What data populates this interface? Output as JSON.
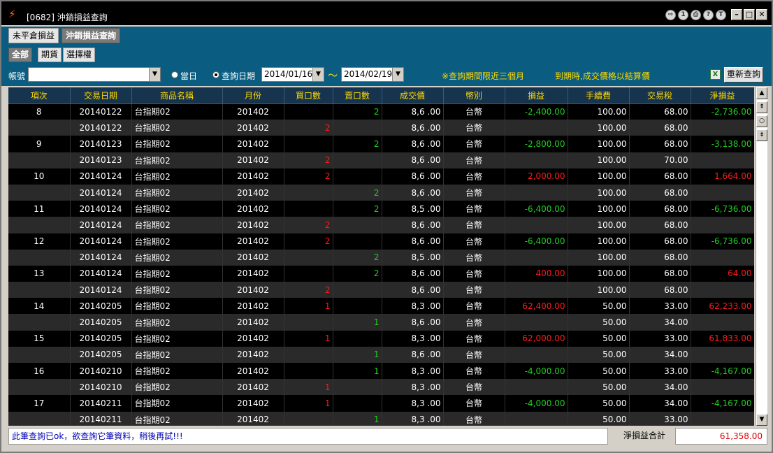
{
  "window": {
    "title": "[0682] 沖銷損益查詢"
  },
  "tabs_top": [
    "未平倉損益",
    "沖銷損益查詢"
  ],
  "tabs_sub": [
    "全部",
    "期貨",
    "選擇權"
  ],
  "filter": {
    "account_label": "帳號",
    "account_value": "",
    "radio_today": "當日",
    "radio_query": "查詢日期",
    "date_from": "2014/01/16",
    "tilde": "～",
    "date_to": "2014/02/19",
    "note1": "※查詢期間限近三個月",
    "note2": "到期時,成交價格以結算價",
    "requery": "重新查詢"
  },
  "columns": [
    "項次",
    "交易日期",
    "商品名稱",
    "月份",
    "買口數",
    "賣口數",
    "成交價",
    "幣別",
    "損益",
    "手續費",
    "交易稅",
    "淨損益"
  ],
  "rows": [
    {
      "no": "8",
      "date": "20140122",
      "name": "台指期02",
      "month": "201402",
      "buy": "",
      "sell": "2",
      "price": "8,6 .00",
      "cur": "台幣",
      "pl": "-2,400.00",
      "fee": "100.00",
      "tax": "68.00",
      "net": "-2,736.00"
    },
    {
      "no": "",
      "date": "20140122",
      "name": "台指期02",
      "month": "201402",
      "buy": "2",
      "sell": "",
      "price": "8,6 .00",
      "cur": "台幣",
      "pl": "",
      "fee": "100.00",
      "tax": "68.00",
      "net": ""
    },
    {
      "no": "9",
      "date": "20140123",
      "name": "台指期02",
      "month": "201402",
      "buy": "",
      "sell": "2",
      "price": "8,6 .00",
      "cur": "台幣",
      "pl": "-2,800.00",
      "fee": "100.00",
      "tax": "68.00",
      "net": "-3,138.00"
    },
    {
      "no": "",
      "date": "20140123",
      "name": "台指期02",
      "month": "201402",
      "buy": "2",
      "sell": "",
      "price": "8,6 .00",
      "cur": "台幣",
      "pl": "",
      "fee": "100.00",
      "tax": "70.00",
      "net": ""
    },
    {
      "no": "10",
      "date": "20140124",
      "name": "台指期02",
      "month": "201402",
      "buy": "2",
      "sell": "",
      "price": "8,6 .00",
      "cur": "台幣",
      "pl": "2,000.00",
      "fee": "100.00",
      "tax": "68.00",
      "net": "1,664.00"
    },
    {
      "no": "",
      "date": "20140124",
      "name": "台指期02",
      "month": "201402",
      "buy": "",
      "sell": "2",
      "price": "8,6 .00",
      "cur": "台幣",
      "pl": "",
      "fee": "100.00",
      "tax": "68.00",
      "net": ""
    },
    {
      "no": "11",
      "date": "20140124",
      "name": "台指期02",
      "month": "201402",
      "buy": "",
      "sell": "2",
      "price": "8,5 .00",
      "cur": "台幣",
      "pl": "-6,400.00",
      "fee": "100.00",
      "tax": "68.00",
      "net": "-6,736.00"
    },
    {
      "no": "",
      "date": "20140124",
      "name": "台指期02",
      "month": "201402",
      "buy": "2",
      "sell": "",
      "price": "8,6 .00",
      "cur": "台幣",
      "pl": "",
      "fee": "100.00",
      "tax": "68.00",
      "net": ""
    },
    {
      "no": "12",
      "date": "20140124",
      "name": "台指期02",
      "month": "201402",
      "buy": "2",
      "sell": "",
      "price": "8,6 .00",
      "cur": "台幣",
      "pl": "-6,400.00",
      "fee": "100.00",
      "tax": "68.00",
      "net": "-6,736.00"
    },
    {
      "no": "",
      "date": "20140124",
      "name": "台指期02",
      "month": "201402",
      "buy": "",
      "sell": "2",
      "price": "8,5 .00",
      "cur": "台幣",
      "pl": "",
      "fee": "100.00",
      "tax": "68.00",
      "net": ""
    },
    {
      "no": "13",
      "date": "20140124",
      "name": "台指期02",
      "month": "201402",
      "buy": "",
      "sell": "2",
      "price": "8,6 .00",
      "cur": "台幣",
      "pl": "400.00",
      "fee": "100.00",
      "tax": "68.00",
      "net": "64.00"
    },
    {
      "no": "",
      "date": "20140124",
      "name": "台指期02",
      "month": "201402",
      "buy": "2",
      "sell": "",
      "price": "8,6 .00",
      "cur": "台幣",
      "pl": "",
      "fee": "100.00",
      "tax": "68.00",
      "net": ""
    },
    {
      "no": "14",
      "date": "20140205",
      "name": "台指期02",
      "month": "201402",
      "buy": "1",
      "sell": "",
      "price": "8,3 .00",
      "cur": "台幣",
      "pl": "62,400.00",
      "fee": "50.00",
      "tax": "33.00",
      "net": "62,233.00"
    },
    {
      "no": "",
      "date": "20140205",
      "name": "台指期02",
      "month": "201402",
      "buy": "",
      "sell": "1",
      "price": "8,6 .00",
      "cur": "台幣",
      "pl": "",
      "fee": "50.00",
      "tax": "34.00",
      "net": ""
    },
    {
      "no": "15",
      "date": "20140205",
      "name": "台指期02",
      "month": "201402",
      "buy": "1",
      "sell": "",
      "price": "8,3 .00",
      "cur": "台幣",
      "pl": "62,000.00",
      "fee": "50.00",
      "tax": "33.00",
      "net": "61,833.00"
    },
    {
      "no": "",
      "date": "20140205",
      "name": "台指期02",
      "month": "201402",
      "buy": "",
      "sell": "1",
      "price": "8,6 .00",
      "cur": "台幣",
      "pl": "",
      "fee": "50.00",
      "tax": "34.00",
      "net": ""
    },
    {
      "no": "16",
      "date": "20140210",
      "name": "台指期02",
      "month": "201402",
      "buy": "",
      "sell": "1",
      "price": "8,3 .00",
      "cur": "台幣",
      "pl": "-4,000.00",
      "fee": "50.00",
      "tax": "33.00",
      "net": "-4,167.00"
    },
    {
      "no": "",
      "date": "20140210",
      "name": "台指期02",
      "month": "201402",
      "buy": "1",
      "sell": "",
      "price": "8,3 .00",
      "cur": "台幣",
      "pl": "",
      "fee": "50.00",
      "tax": "34.00",
      "net": ""
    },
    {
      "no": "17",
      "date": "20140211",
      "name": "台指期02",
      "month": "201402",
      "buy": "1",
      "sell": "",
      "price": "8,3 .00",
      "cur": "台幣",
      "pl": "-4,000.00",
      "fee": "50.00",
      "tax": "34.00",
      "net": "-4,167.00"
    },
    {
      "no": "",
      "date": "20140211",
      "name": "台指期02",
      "month": "201402",
      "buy": "",
      "sell": "1",
      "price": "8,3 .00",
      "cur": "台幣",
      "pl": "",
      "fee": "50.00",
      "tax": "33.00",
      "net": ""
    }
  ],
  "status": {
    "message": "此筆查詢已ok，欲查詢它筆資料，稍後再試!!!",
    "total_label": "淨損益合計",
    "total_value": "61,358.00"
  },
  "colors": {
    "header_bg": "#17344e",
    "header_fg": "#ffd800",
    "profit": "#ff1a1a",
    "loss": "#22cc22",
    "toolbar_bg": "#0a5d80"
  },
  "icons": [
    "lightning-icon",
    "pin-icon",
    "info-icon",
    "print-icon",
    "help-icon",
    "t-icon",
    "minimize-icon",
    "maximize-icon",
    "close-icon",
    "excel-icon"
  ]
}
